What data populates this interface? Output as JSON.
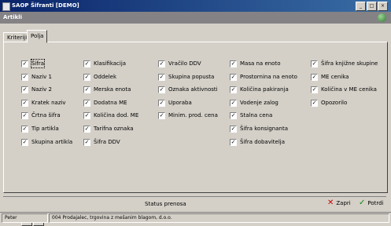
{
  "window": {
    "title": "SAOP Šifranti [DEMO]",
    "minimize": "_",
    "maximize": "□",
    "close": "×"
  },
  "subwindow": {
    "title": "Artikli"
  },
  "tabs": [
    {
      "label": "Kriteriji"
    },
    {
      "label": "Polja"
    }
  ],
  "columns": [
    [
      "Šifra",
      "Naziv 1",
      "Naziv 2",
      "Kratek naziv",
      "Črtna šifra",
      "Tip artikla",
      "Skupina artikla"
    ],
    [
      "Klasifikacija",
      "Oddelek",
      "Merska enota",
      "Dodatna ME",
      "Količina dod. ME",
      "Tarifna oznaka",
      "Šifra DDV"
    ],
    [
      "Vračilo DDV",
      "Skupina popusta",
      "Oznaka aktivnosti",
      "Uporaba",
      "Minim. prod. cena"
    ],
    [
      "Masa na enoto",
      "Prostornina na enoto",
      "Količina pakiranja",
      "Vodenje zalog",
      "Stalna cena",
      "Šifra konsignanta",
      "Šifra dobavitelja"
    ],
    [
      "Šifra knjižne skupine",
      "ME cenika",
      "Količina v ME cenika",
      "Opozorilo"
    ]
  ],
  "buttons": {
    "check_all": "✓",
    "uncheck_all": "✕",
    "cancel": "Zapri",
    "confirm": "Potrdi"
  },
  "status": {
    "center": "Status prenosa",
    "user": "Peter",
    "company": "004 Prodajalec, trgovina z mešanim blagom, d.o.o."
  }
}
